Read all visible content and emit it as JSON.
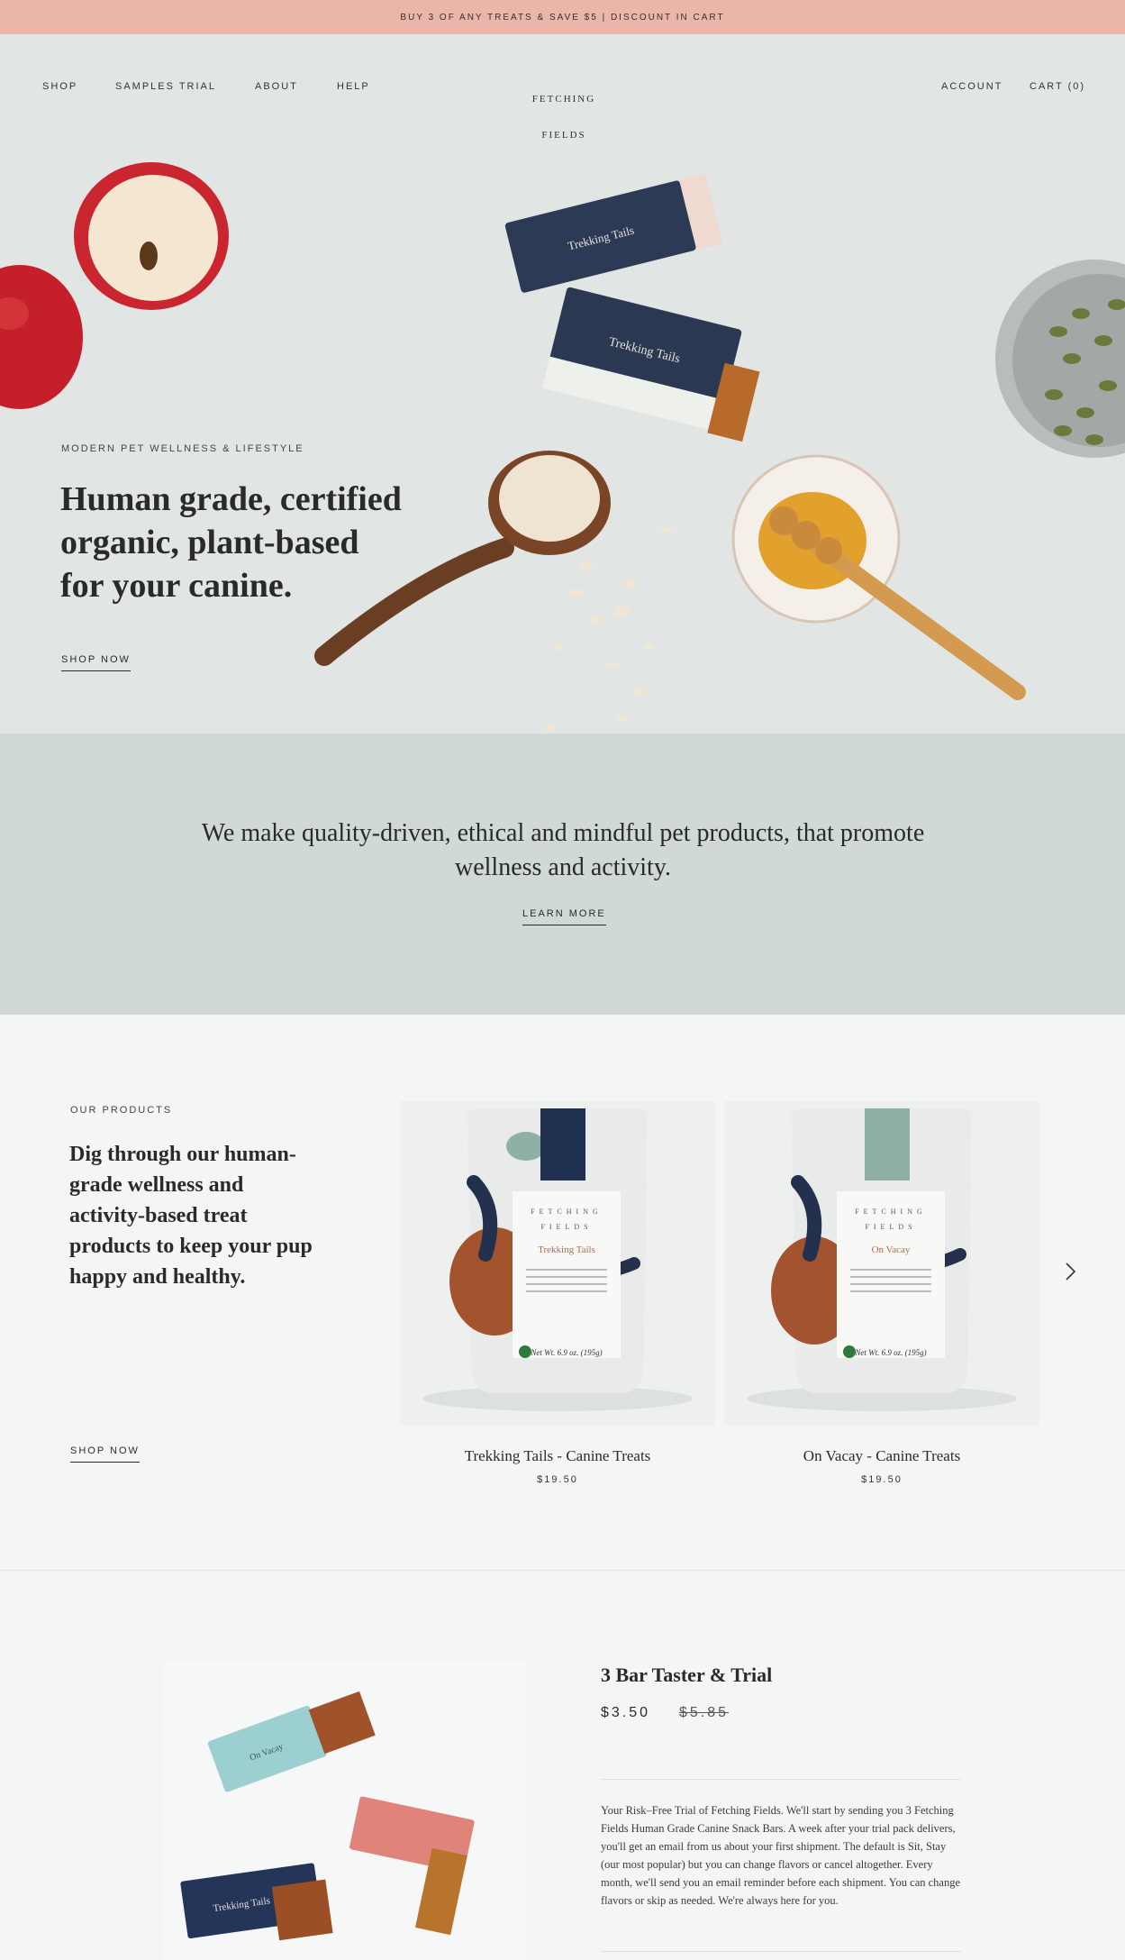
{
  "announcement": "BUY 3 OF ANY TREATS & SAVE $5 | DISCOUNT IN CART",
  "nav": {
    "left": [
      "SHOP",
      "SAMPLES TRIAL",
      "ABOUT",
      "HELP"
    ],
    "logo_line1": "FETCHING",
    "logo_line2": "FIELDS",
    "account": "ACCOUNT",
    "cart": "CART (0)"
  },
  "hero": {
    "eyebrow": "MODERN PET WELLNESS & LIFESTYLE",
    "title": "Human grade, certified organic, plant-based for your canine.",
    "cta": "SHOP NOW",
    "bar_label": "Trekking Tails"
  },
  "mission": {
    "text": "We make quality-driven, ethical and mindful pet products, that promote wellness and activity.",
    "cta": "LEARN MORE"
  },
  "products": {
    "eyebrow": "OUR PRODUCTS",
    "title": "Dig through our human-grade wellness and activity-based treat products to keep your pup happy and healthy.",
    "cta": "SHOP NOW",
    "items": [
      {
        "name": "Trekking Tails - Canine Treats",
        "price": "$19.50",
        "flavor": "Trekking Tails",
        "tag_color": "#1f3050"
      },
      {
        "name": "On Vacay - Canine Treats",
        "price": "$19.50",
        "flavor": "On Vacay",
        "tag_color": "#8fb0a6"
      }
    ],
    "bag_brand_line1": "FETCHING",
    "bag_brand_line2": "FIELDS",
    "bag_weight": "Net Wt. 6.9 oz. (195g)"
  },
  "trial": {
    "title": "3 Bar Taster & Trial",
    "price": "$3.50",
    "compare_price": "$5.85",
    "description": "Your Risk–Free Trial of Fetching Fields.  We'll start by sending you 3 Fetching Fields Human Grade Canine Snack Bars.  A week after your trial pack delivers, you'll get an email from us about your first shipment.  The default is Sit, Stay (our most popular) but you can change flavors or cancel altogether.  Every month, we'll send you an email reminder before each shipment.  You can change flavors or skip as needed.  We're always here for you.",
    "bar_labels": [
      "On Vacay",
      "Trekking Tails"
    ]
  }
}
